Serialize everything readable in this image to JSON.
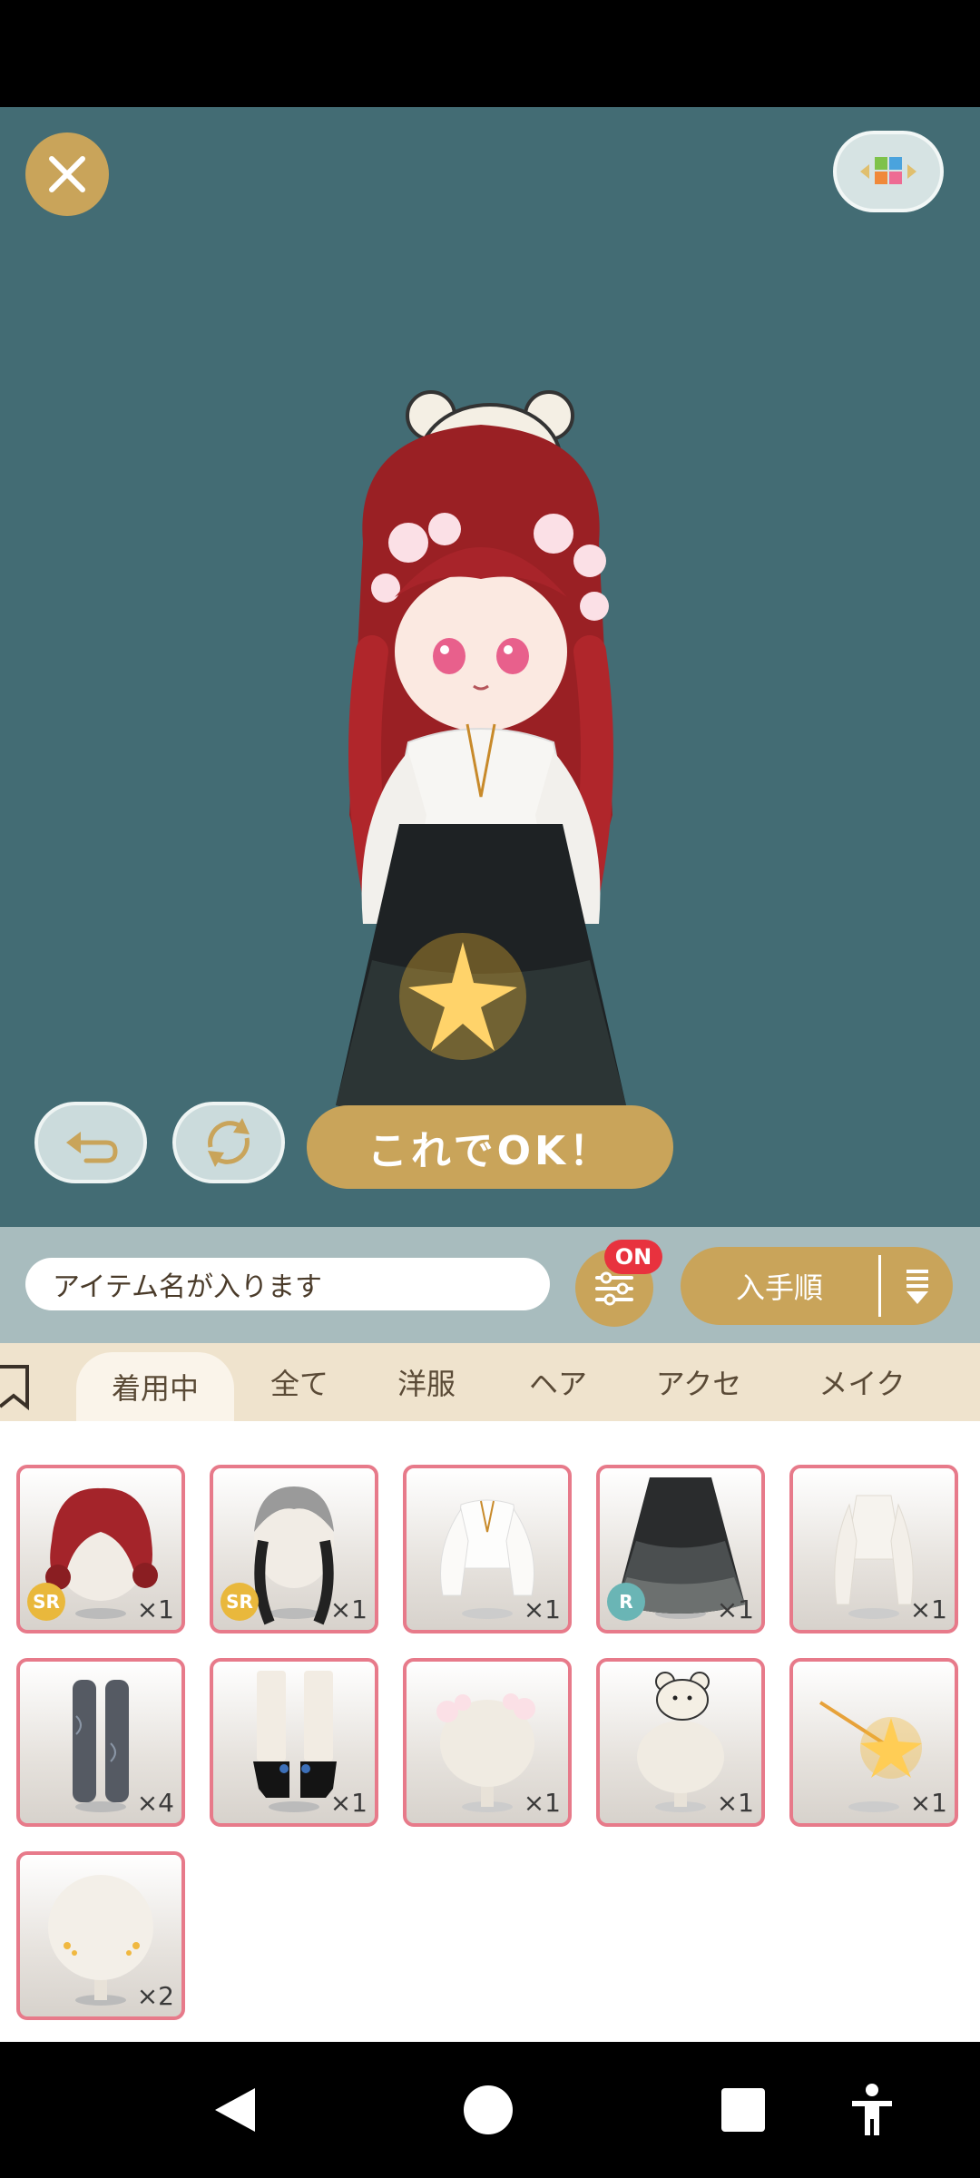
{
  "stage": {
    "ok_button_label": "これでOK！"
  },
  "search": {
    "placeholder": "アイテム名が入ります",
    "filter_badge": "ON",
    "sort_label": "入手順"
  },
  "tabs": [
    {
      "label": "着用中",
      "active": true
    },
    {
      "label": "全て",
      "active": false
    },
    {
      "label": "洋服",
      "active": false
    },
    {
      "label": "ヘア",
      "active": false
    },
    {
      "label": "アクセ",
      "active": false
    },
    {
      "label": "メイク",
      "active": false
    }
  ],
  "items": [
    {
      "kind": "red-curly-hair",
      "rarity": "SR",
      "quantity": "×1"
    },
    {
      "kind": "silver-braid-hair",
      "rarity": "SR",
      "quantity": "×1"
    },
    {
      "kind": "white-blouse",
      "rarity": "",
      "quantity": "×1"
    },
    {
      "kind": "black-tulle-skirt",
      "rarity": "R",
      "quantity": "×1"
    },
    {
      "kind": "white-sweater",
      "rarity": "",
      "quantity": "×1"
    },
    {
      "kind": "patterned-tights",
      "rarity": "",
      "quantity": "×4"
    },
    {
      "kind": "black-boots",
      "rarity": "",
      "quantity": "×1"
    },
    {
      "kind": "flower-crown",
      "rarity": "",
      "quantity": "×1"
    },
    {
      "kind": "bear-hat",
      "rarity": "",
      "quantity": "×1"
    },
    {
      "kind": "star-wand",
      "rarity": "",
      "quantity": "×1"
    },
    {
      "kind": "cheek-makeup",
      "rarity": "",
      "quantity": "×2"
    }
  ],
  "colors": {
    "stage_bg": "#436c74",
    "accent_gold": "#c9a45a",
    "item_border": "#e77a8a",
    "badge_red": "#e8323e"
  }
}
